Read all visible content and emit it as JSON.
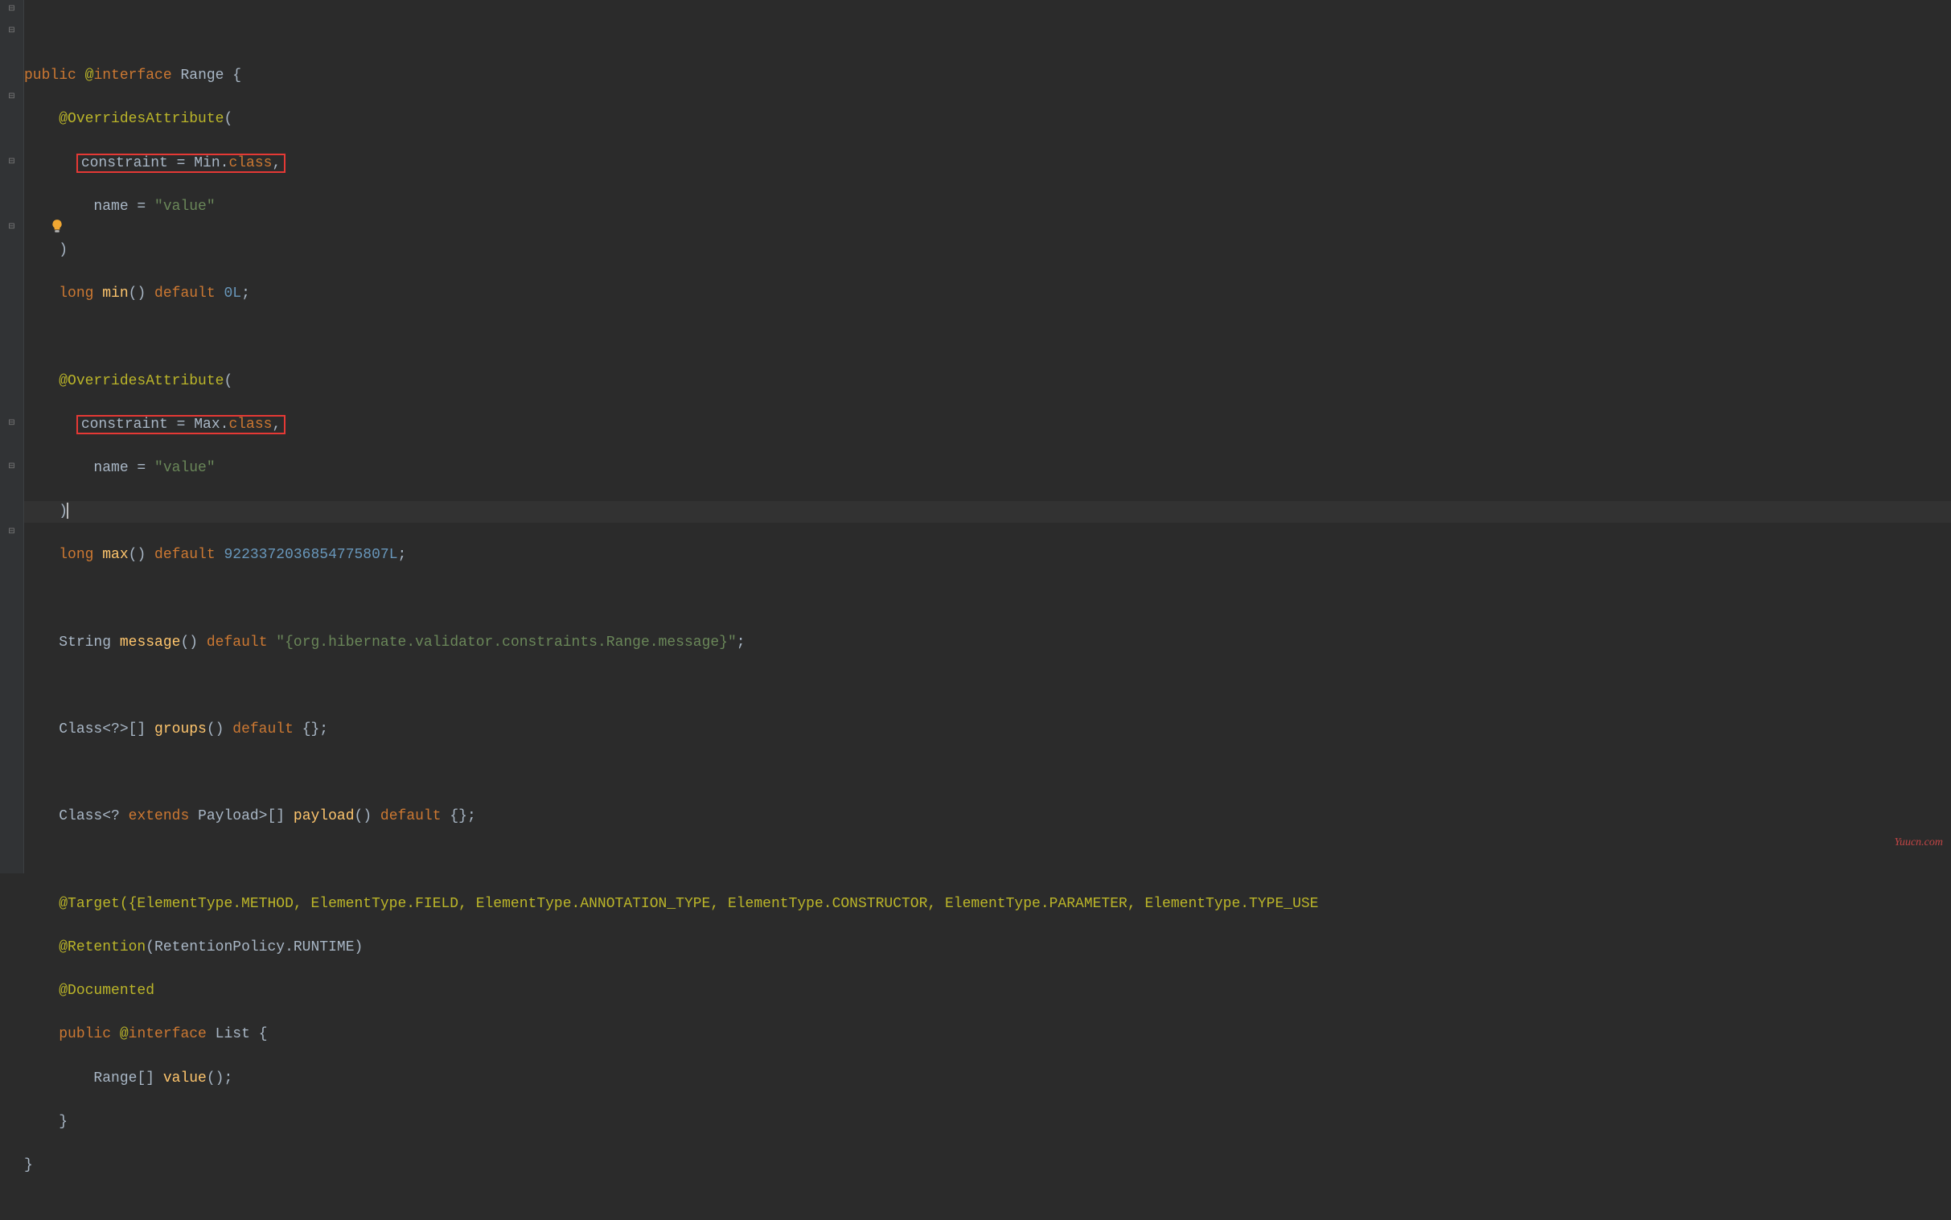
{
  "watermark": "Yuucn.com",
  "code": {
    "l1": {
      "kw_public": "public",
      "ann_at": "@",
      "kw_interface": "interface ",
      "name": "Range",
      "brace": " {"
    },
    "l2": {
      "ann": "@OverridesAttribute",
      "paren": "("
    },
    "l3": {
      "boxed": "constraint = Min.class,"
    },
    "l3_parts": {
      "attr": "constraint = Min.",
      "cls": "class",
      "comma": ","
    },
    "l4": {
      "name_eq": "name = ",
      "val": "\"value\""
    },
    "l5": {
      "paren": ")"
    },
    "l6": {
      "kw_long": "long ",
      "method": "min",
      "parens": "()",
      "kw_default": " default ",
      "val": "0L",
      "semi": ";"
    },
    "l8": {
      "ann": "@OverridesAttribute",
      "paren": "("
    },
    "l9": {
      "boxed": "constraint = Max.class,"
    },
    "l9_parts": {
      "attr": "constraint = Max.",
      "cls": "class",
      "comma": ","
    },
    "l10": {
      "name_eq": "name = ",
      "val": "\"value\""
    },
    "l11": {
      "paren": ")"
    },
    "l12": {
      "kw_long": "long ",
      "method": "max",
      "parens": "()",
      "kw_default": " default ",
      "val": "9223372036854775807L",
      "semi": ";"
    },
    "l14": {
      "type": "String ",
      "method": "message",
      "parens": "()",
      "kw_default": " default ",
      "val": "\"{org.hibernate.validator.constraints.Range.message}\"",
      "semi": ";"
    },
    "l16": {
      "pre": "Class<?>[] ",
      "method": "groups",
      "parens": "()",
      "kw_default": " default ",
      "braces": "{}",
      "semi": ";"
    },
    "l18": {
      "pre1": "Class<? ",
      "kw_extends": "extends ",
      "pre2": "Payload>[] ",
      "method": "payload",
      "parens": "()",
      "kw_default": " default ",
      "braces": "{}",
      "semi": ";"
    },
    "l20": {
      "full": "@Target({ElementType.METHOD, ElementType.FIELD, ElementType.ANNOTATION_TYPE, ElementType.CONSTRUCTOR, ElementType.PARAMETER, ElementType.TYPE_USE"
    },
    "l21": {
      "ann": "@Retention",
      "args": "(RetentionPolicy.RUNTIME)"
    },
    "l22": {
      "ann": "@Documented"
    },
    "l23": {
      "kw_public": "public",
      "ann_at": " @",
      "kw_interface": "interface ",
      "name": "List",
      "brace": " {"
    },
    "l24": {
      "type": "Range[] ",
      "method": "value",
      "parens": "()",
      "semi": ";"
    },
    "l25": {
      "brace": "}"
    },
    "l26": {
      "brace": "}"
    }
  },
  "icons": {
    "fold_open": "⊟",
    "fold_close": "⊟",
    "bulb": "bulb-icon"
  }
}
